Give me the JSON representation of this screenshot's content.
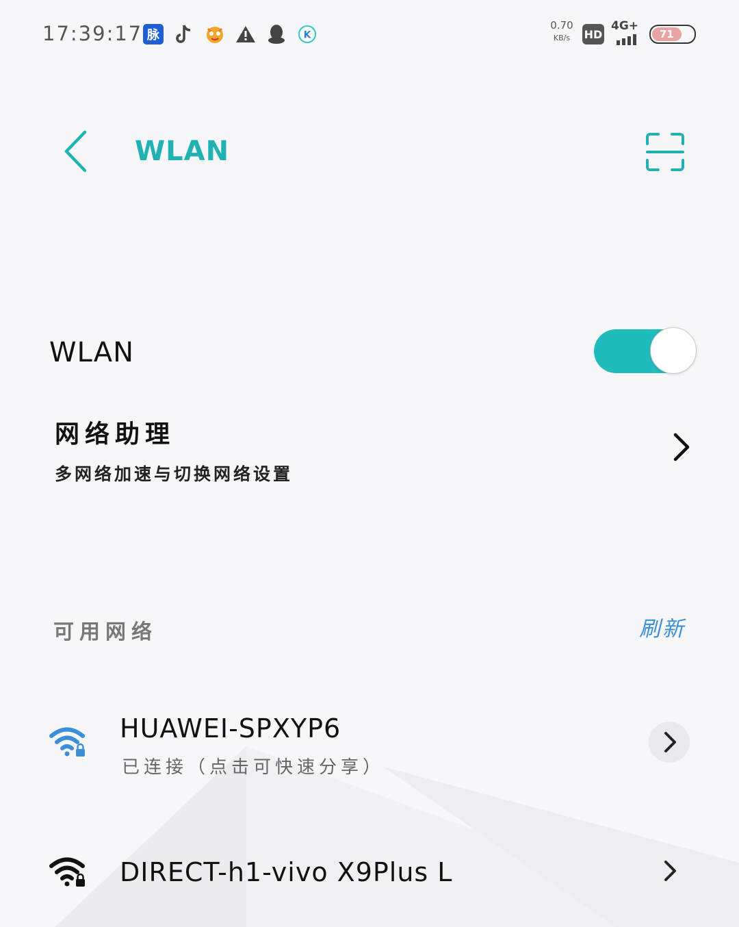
{
  "status_bar": {
    "time": "17:39:17",
    "app_icons": [
      "mai-app-icon",
      "tiktok-icon",
      "game-app-icon",
      "warning-icon",
      "qq-penguin-icon",
      "k-app-icon"
    ],
    "net_speed_value": "0.70",
    "net_speed_unit": "KB/s",
    "hd_label": "HD",
    "network_type": "4G+",
    "battery_level": "71"
  },
  "header": {
    "title": "WLAN",
    "back_icon": "chevron-left-icon",
    "scan_icon": "scan-qr-icon"
  },
  "wlan_toggle": {
    "label": "WLAN",
    "enabled": true
  },
  "network_assistant": {
    "title": "网络助理",
    "subtitle": "多网络加速与切换网络设置"
  },
  "available_networks": {
    "label": "可用网络",
    "refresh_label": "刷新",
    "items": [
      {
        "name": "HUAWEI-SPXYP6",
        "status": "已连接（点击可快速分享）",
        "connected": true,
        "secured": true
      },
      {
        "name": "DIRECT-h1-vivo X9Plus L",
        "status": "",
        "connected": false,
        "secured": true
      }
    ]
  },
  "colors": {
    "accent": "#20b2b2",
    "toggle_on": "#20bcbc",
    "link": "#3b8fd9",
    "connected_wifi": "#3b8fd9"
  }
}
